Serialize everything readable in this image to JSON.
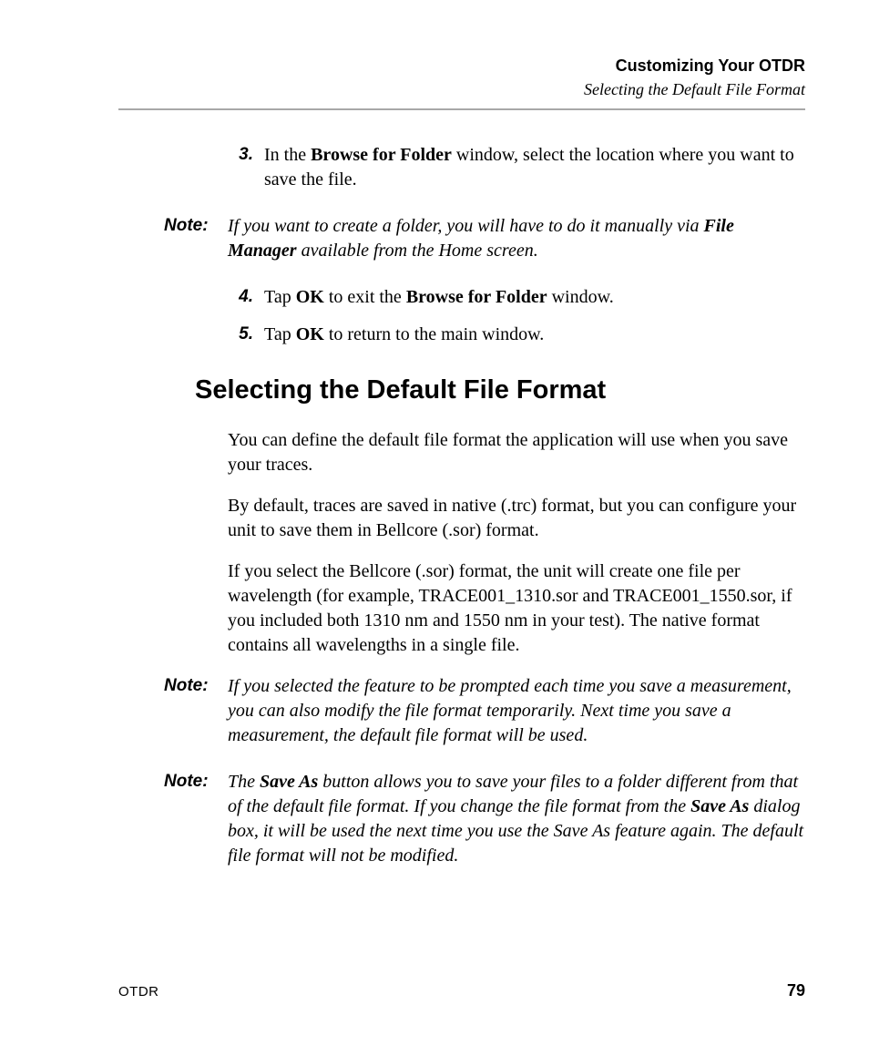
{
  "header": {
    "chapter_title": "Customizing Your OTDR",
    "section_title": "Selecting the Default File Format"
  },
  "steps_top": [
    {
      "num": "3.",
      "prefix": "In the ",
      "bold1": "Browse for Folder",
      "suffix": " window, select the location where you want to save the file."
    }
  ],
  "note1": {
    "label": "Note:",
    "part1": "If you want to create a folder, you will have to do it manually via ",
    "bold1": "File Manager",
    "part2": " available from the Home screen."
  },
  "steps_mid": [
    {
      "num": "4.",
      "t1": "Tap ",
      "b1": "OK",
      "t2": " to exit the ",
      "b2": "Browse for Folder",
      "t3": " window."
    },
    {
      "num": "5.",
      "t1": "Tap ",
      "b1": "OK",
      "t2": " to return to the main window.",
      "b2": "",
      "t3": ""
    }
  ],
  "heading": "Selecting the Default File Format",
  "body": {
    "p1": "You can define the default file format the application will use when you save your traces.",
    "p2": "By default, traces are saved in native (.trc) format, but you can configure your unit to save them in Bellcore (.sor) format.",
    "p3": "If you select the Bellcore (.sor) format, the unit will create one file per wavelength (for example, TRACE001_1310.sor and TRACE001_1550.sor, if you included both 1310 nm and 1550 nm in your test). The native format contains all wavelengths in a single file."
  },
  "note2": {
    "label": "Note:",
    "text": "If you selected the feature to be prompted each time you save a measurement, you can also modify the file format temporarily. Next time you save a measurement, the default file format will be used."
  },
  "note3": {
    "label": "Note:",
    "t1": "The ",
    "b1": "Save As",
    "t2": " button allows you to save your files to a folder different from that of the default file format. If you change the file format from the ",
    "b2": "Save As",
    "t3": " dialog box, it will be used the next time you use the Save As feature again. The default file format will not be modified."
  },
  "footer": {
    "doc": "OTDR",
    "page": "79"
  }
}
